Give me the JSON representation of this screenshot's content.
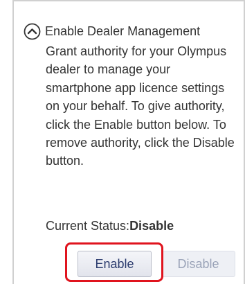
{
  "section": {
    "title": "Enable Dealer Management",
    "toggle_icon": "chevron-up-circle-icon",
    "description": "Grant authority for your Olympus dealer to manage your smartphone app licence settings on your behalf. To give authority, click the Enable button below. To remove authority, click the Disable button."
  },
  "status": {
    "label": "Current Status:",
    "value": "Disable"
  },
  "buttons": {
    "enable_label": "Enable",
    "disable_label": "Disable"
  },
  "colors": {
    "highlight": "#e0141e",
    "enable_text": "#2b3b6e",
    "disable_text": "#9aa3b8",
    "border": "#d0d0d0"
  }
}
